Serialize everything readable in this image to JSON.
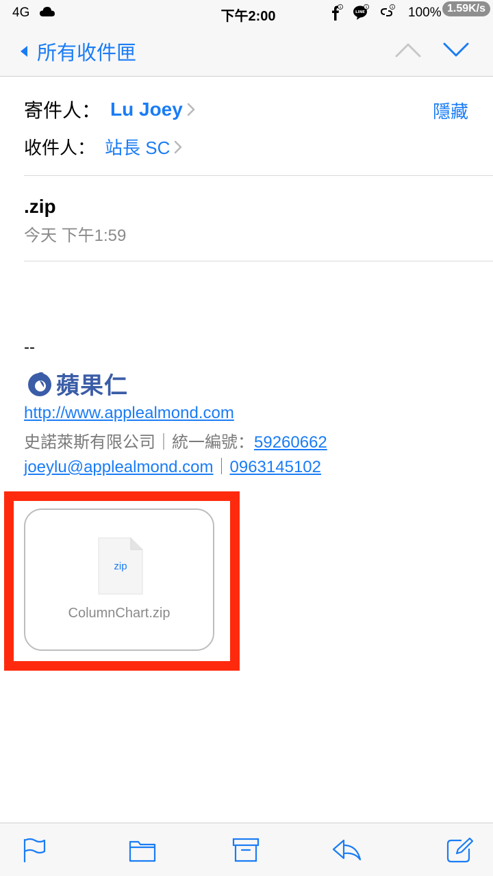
{
  "status_bar": {
    "network": "4G",
    "time": "下午2:00",
    "battery": "100%",
    "speed": "1.59K/s",
    "icons": [
      "facebook-icon",
      "line-icon",
      "link-icon",
      "cloud-icon",
      "battery-icon"
    ],
    "notification_badge": "1"
  },
  "nav": {
    "back_label": "所有收件匣",
    "accent_color": "#1a7cf5"
  },
  "header": {
    "from_label": "寄件人：",
    "from_name": "Lu Joey",
    "to_label": "收件人：",
    "to_name": "站長 SC",
    "hide_label": "隱藏"
  },
  "message": {
    "subject": ".zip",
    "date": "今天 下午1:59"
  },
  "signature": {
    "dash": "--",
    "logo_text": "蘋果仁",
    "website": "http://www.applealmond.com",
    "company": "史諾萊斯有限公司｜統一編號：",
    "tax_id": "59260662",
    "email": "joeylu@applealmond.com",
    "separator": "｜",
    "phone": "0963145102"
  },
  "attachment": {
    "ext": "zip",
    "filename": "ColumnChart.zip",
    "highlight_color": "#ff2a0d"
  },
  "toolbar": {
    "icons": [
      "flag-icon",
      "folder-icon",
      "archive-icon",
      "reply-icon",
      "compose-icon"
    ]
  }
}
